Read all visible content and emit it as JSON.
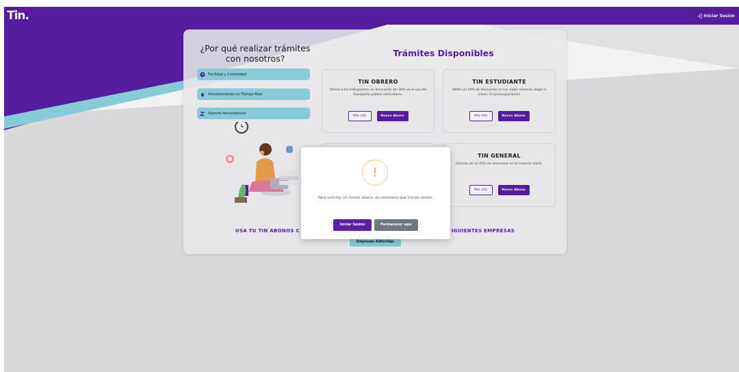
{
  "header": {
    "logo_text": "Tin.",
    "login_label": "Iniciar Sesión"
  },
  "why": {
    "title": "¿Por qué realizar trámites con nosotros?",
    "features": [
      {
        "label": "Facilidad y Comodidad",
        "icon": "clock-icon"
      },
      {
        "label": "Actualizaciones en Tiempo Real",
        "icon": "bell-icon"
      },
      {
        "label": "Soporte Personalizado",
        "icon": "users-icon"
      }
    ]
  },
  "tramites": {
    "title": "Trámites Disponibles",
    "info_label": "Más info",
    "abono_label": "Nuevo Abono",
    "cards": [
      {
        "name": "TIN OBRERO",
        "desc": "Ofrece a los trabajadores un descuento del 30% en el uso del transporte público interurbano."
      },
      {
        "name": "TIN ESTUDIANTE",
        "desc": "Obtén un 50% de descuento en tus viajes mientras llegas a clases sin preocupaciones!"
      },
      {
        "name": "",
        "desc": ""
      },
      {
        "name": "TIN GENERAL",
        "desc": "Disfruta de un 25% de descuento en tu trayecto diario."
      }
    ]
  },
  "bottom": {
    "usa_text_left": "USA TU TIN ABONOS C",
    "usa_text_right": "IGUIENTES EMPRESAS",
    "empresas_label": "Empresas Adheridas"
  },
  "modal": {
    "icon": "warning-icon",
    "icon_glyph": "!",
    "message": "Para solicitar un nuevo abono, es necesario que inicies sesión.",
    "primary_label": "Iniciar Sesión",
    "secondary_label": "Permanecer aquí"
  },
  "colors": {
    "brand": "#5a1fa6",
    "accent": "#8ed7e3",
    "warning": "#f0a44a",
    "secondary_button": "#6e7781"
  }
}
